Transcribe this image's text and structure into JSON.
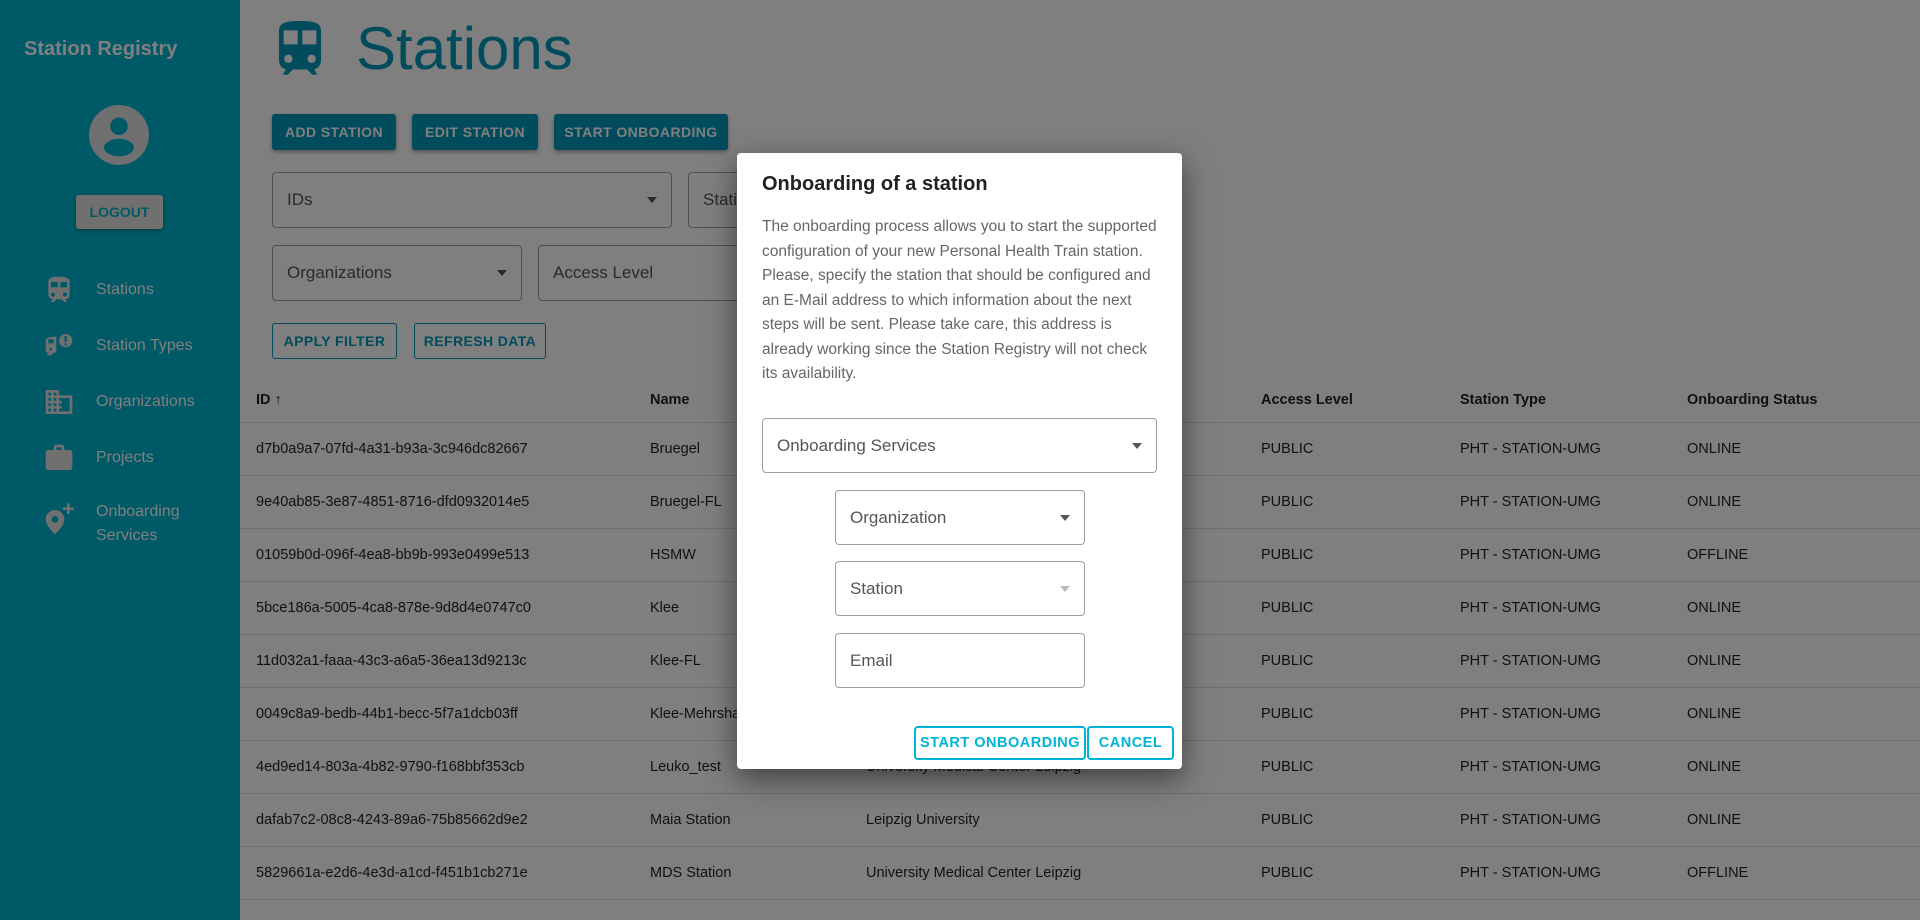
{
  "sidebar": {
    "brand": "Station Registry",
    "logout_label": "LOGOUT",
    "items": [
      {
        "label": "Stations",
        "icon": "train-icon"
      },
      {
        "label": "Station Types",
        "icon": "train-alert-icon"
      },
      {
        "label": "Organizations",
        "icon": "domain-icon"
      },
      {
        "label": "Projects",
        "icon": "briefcase-icon"
      },
      {
        "label": "Onboarding",
        "label2": "Services",
        "icon": "map-marker-plus-icon"
      }
    ]
  },
  "page": {
    "title": "Stations",
    "buttons": {
      "add": "ADD STATION",
      "edit": "EDIT STATION",
      "onboard": "START ONBOARDING",
      "apply": "APPLY FILTER",
      "refresh": "REFRESH DATA"
    },
    "filters": {
      "ids": "IDs",
      "station": "Station",
      "organizations": "Organizations",
      "access_level": "Access Level"
    }
  },
  "table": {
    "headers": {
      "id": "ID",
      "sort_icon": "arrow-up-icon",
      "name": "Name",
      "access": "Access Level",
      "type": "Station Type",
      "status": "Onboarding Status"
    },
    "rows": [
      {
        "id": "d7b0a9a7-07fd-4a31-b93a-3c946dc82667",
        "name": "Bruegel",
        "org": "",
        "access": "PUBLIC",
        "type": "PHT - STATION-UMG",
        "status": "ONLINE"
      },
      {
        "id": "9e40ab85-3e87-4851-8716-dfd0932014e5",
        "name": "Bruegel-FL",
        "org": "",
        "access": "PUBLIC",
        "type": "PHT - STATION-UMG",
        "status": "ONLINE"
      },
      {
        "id": "01059b0d-096f-4ea8-bb9b-993e0499e513",
        "name": "HSMW",
        "org": "",
        "access": "PUBLIC",
        "type": "PHT - STATION-UMG",
        "status": "OFFLINE"
      },
      {
        "id": "5bce186a-5005-4ca8-878e-9d8d4e0747c0",
        "name": "Klee",
        "org": "",
        "access": "PUBLIC",
        "type": "PHT - STATION-UMG",
        "status": "ONLINE"
      },
      {
        "id": "11d032a1-faaa-43c3-a6a5-36ea13d9213c",
        "name": "Klee-FL",
        "org": "",
        "access": "PUBLIC",
        "type": "PHT - STATION-UMG",
        "status": "ONLINE"
      },
      {
        "id": "0049c8a9-bedb-44b1-becc-5f7a1dcb03ff",
        "name": "Klee-Mehrsha",
        "org": "",
        "access": "PUBLIC",
        "type": "PHT - STATION-UMG",
        "status": "ONLINE"
      },
      {
        "id": "4ed9ed14-803a-4b82-9790-f168bbf353cb",
        "name": "Leuko_test",
        "org": "University Medical Center Leipzig",
        "access": "PUBLIC",
        "type": "PHT - STATION-UMG",
        "status": "ONLINE"
      },
      {
        "id": "dafab7c2-08c8-4243-89a6-75b85662d9e2",
        "name": "Maia Station",
        "org": "Leipzig University",
        "access": "PUBLIC",
        "type": "PHT - STATION-UMG",
        "status": "ONLINE"
      },
      {
        "id": "5829661a-e2d6-4e3d-a1cd-f451b1cb271e",
        "name": "MDS Station",
        "org": "University Medical Center Leipzig",
        "access": "PUBLIC",
        "type": "PHT - STATION-UMG",
        "status": "OFFLINE"
      }
    ]
  },
  "dialog": {
    "title": "Onboarding of a station",
    "body1": "The onboarding process allows you to start the supported configuration of your new Personal Health Train station.",
    "body2": "Please, specify the station that should be configured and an E-Mail address to which information about the next steps will be sent. Please take care, this address is already working since the Station Registry will not check its availability.",
    "onboarding_services": "Onboarding Services",
    "organization": "Organization",
    "station": "Station",
    "email": "Email",
    "start": "START ONBOARDING",
    "cancel": "CANCEL"
  },
  "colors": {
    "accent": "#00b4d8",
    "sidebar": "#00b2cc"
  }
}
